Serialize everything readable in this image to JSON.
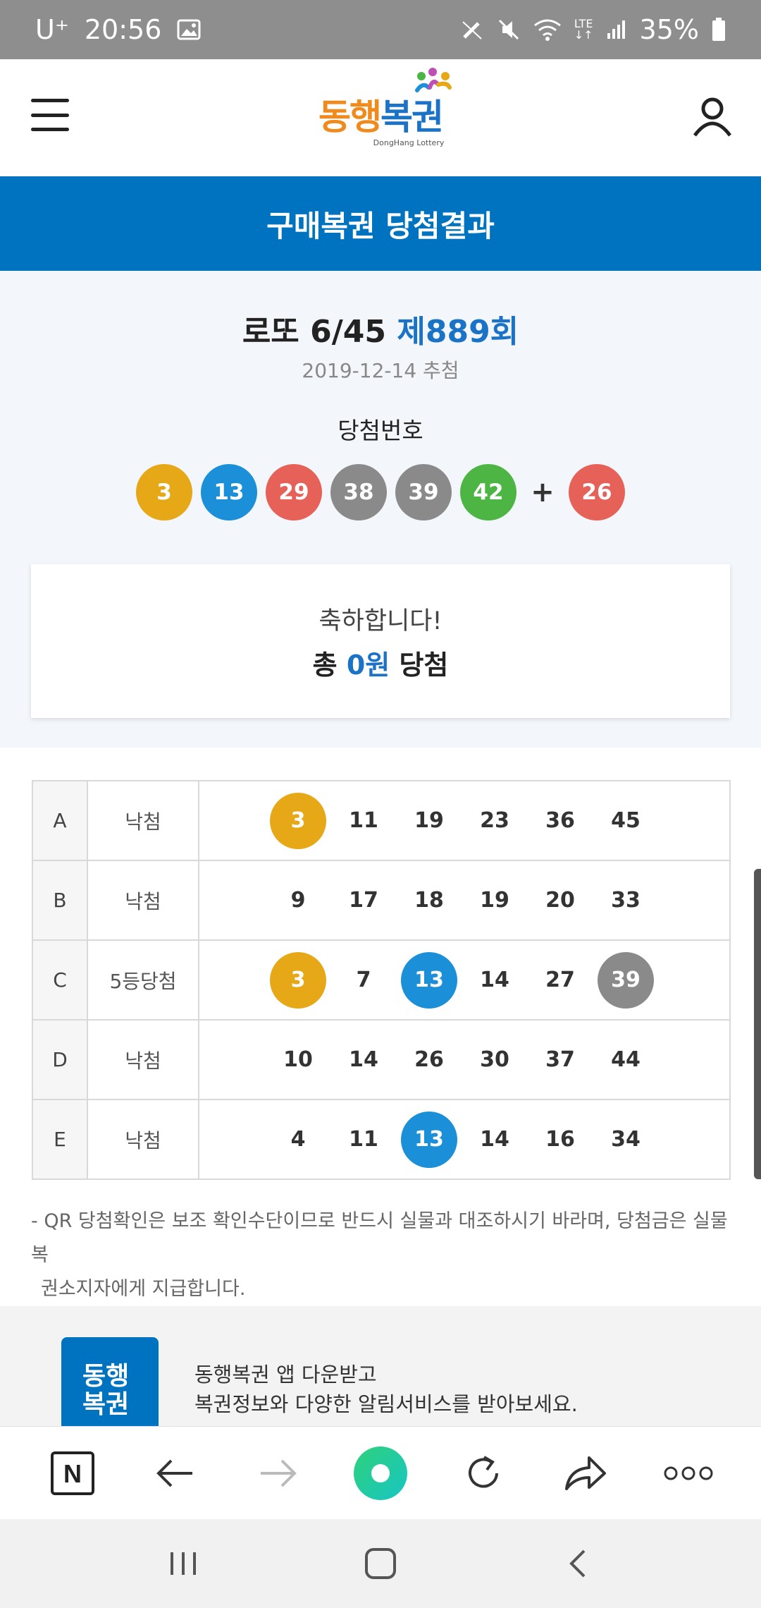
{
  "status_bar": {
    "carrier": "U⁺",
    "time": "20:56",
    "battery": "35%",
    "network": "LTE",
    "icons": [
      "gallery-icon",
      "pen-icon",
      "mute-icon",
      "wifi-icon",
      "lte-icon",
      "signal-icon",
      "battery-icon"
    ]
  },
  "header": {
    "logo_part1": "동행",
    "logo_part2": "복권",
    "logo_sub": "DongHang Lottery",
    "icons": [
      "menu-icon",
      "user-icon"
    ]
  },
  "banner": {
    "title": "구매복권 당첨결과"
  },
  "draw": {
    "game": "로또 6/45",
    "round": "제889회",
    "date": "2019-12-14 추첨",
    "numbers_label": "당첨번호",
    "numbers": [
      {
        "n": "3",
        "color": "#e6a817"
      },
      {
        "n": "13",
        "color": "#1b8fd8"
      },
      {
        "n": "29",
        "color": "#e66157"
      },
      {
        "n": "38",
        "color": "#8a8a8a"
      },
      {
        "n": "39",
        "color": "#8a8a8a"
      },
      {
        "n": "42",
        "color": "#4cb543"
      }
    ],
    "plus": "+",
    "bonus": {
      "n": "26",
      "color": "#e66157"
    }
  },
  "congrats": {
    "line1": "축하합니다!",
    "prefix": "총",
    "amount": "0원",
    "suffix": "당첨"
  },
  "games": [
    {
      "letter": "A",
      "result": "낙첨",
      "nums": [
        {
          "n": "3",
          "color": "#e6a817"
        },
        {
          "n": "11"
        },
        {
          "n": "19"
        },
        {
          "n": "23"
        },
        {
          "n": "36"
        },
        {
          "n": "45"
        }
      ]
    },
    {
      "letter": "B",
      "result": "낙첨",
      "nums": [
        {
          "n": "9"
        },
        {
          "n": "17"
        },
        {
          "n": "18"
        },
        {
          "n": "19"
        },
        {
          "n": "20"
        },
        {
          "n": "33"
        }
      ]
    },
    {
      "letter": "C",
      "result": "5등당첨",
      "nums": [
        {
          "n": "3",
          "color": "#e6a817"
        },
        {
          "n": "7"
        },
        {
          "n": "13",
          "color": "#1b8fd8"
        },
        {
          "n": "14"
        },
        {
          "n": "27"
        },
        {
          "n": "39",
          "color": "#8a8a8a"
        }
      ]
    },
    {
      "letter": "D",
      "result": "낙첨",
      "nums": [
        {
          "n": "10"
        },
        {
          "n": "14"
        },
        {
          "n": "26"
        },
        {
          "n": "30"
        },
        {
          "n": "37"
        },
        {
          "n": "44"
        }
      ]
    },
    {
      "letter": "E",
      "result": "낙첨",
      "nums": [
        {
          "n": "4"
        },
        {
          "n": "11"
        },
        {
          "n": "13",
          "color": "#1b8fd8"
        },
        {
          "n": "14"
        },
        {
          "n": "16"
        },
        {
          "n": "34"
        }
      ]
    }
  ],
  "note": {
    "line1": "- QR 당첨확인은 보조 확인수단이므로 반드시 실물과 대조하시기 바라며, 당첨금은 실물 복",
    "line2": "권소지자에게 지급합니다."
  },
  "promo": {
    "icon_line1": "동행",
    "icon_line2": "복권",
    "line1": "동행복권 앱 다운받고",
    "line2": "복권정보와 다양한 알림서비스를 받아보세요."
  },
  "browser_bar": {
    "icons": [
      "naver-icon",
      "back-icon",
      "forward-icon",
      "green-dot-icon",
      "refresh-icon",
      "share-icon",
      "more-icon"
    ],
    "naver_label": "N"
  },
  "nav_bar": {
    "icons": [
      "recent-apps-icon",
      "home-icon",
      "back-nav-icon"
    ]
  },
  "colors": {
    "brand_blue": "#0073c0",
    "accent_blue": "#1a73c7",
    "logo_orange": "#f08a1c"
  }
}
